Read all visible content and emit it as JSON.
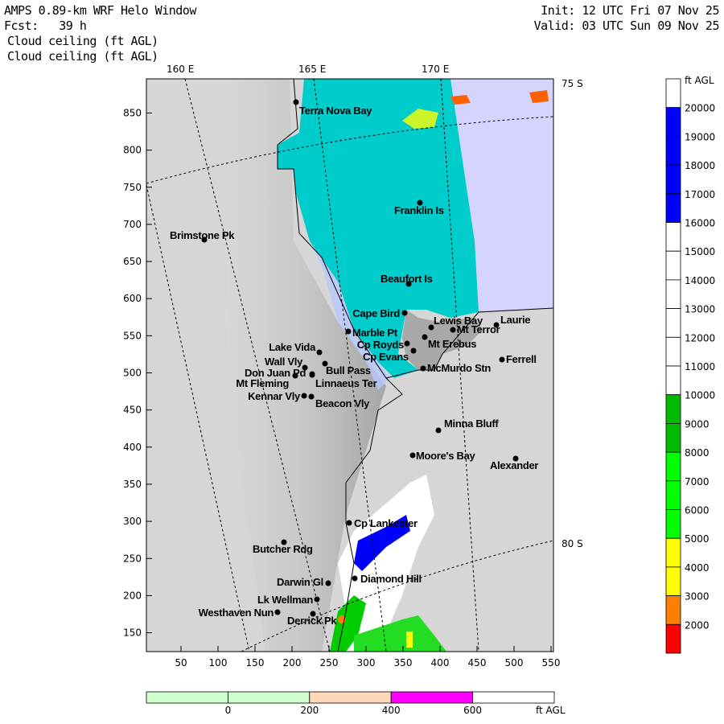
{
  "header": {
    "title": "AMPS 0.89-km WRF Helo Window",
    "forecast": "Fcst:   39 h",
    "field1": "Cloud ceiling (ft AGL)",
    "field2": "Cloud ceiling (ft AGL)",
    "init": "Init: 12 UTC Fri 07 Nov 25",
    "valid": "Valid: 03 UTC Sun 09 Nov 25"
  },
  "map": {
    "lon_labels": [
      "160 E",
      "165 E",
      "170 E"
    ],
    "lat_labels": [
      "75 S",
      "80 S"
    ],
    "x_ticks": [
      "50",
      "100",
      "150",
      "200",
      "250",
      "300",
      "350",
      "400",
      "450",
      "500",
      "550"
    ],
    "y_ticks": [
      "850",
      "800",
      "750",
      "700",
      "650",
      "600",
      "550",
      "500",
      "450",
      "400",
      "350",
      "300",
      "250",
      "200",
      "150"
    ],
    "stations": [
      "Terra Nova Bay",
      "Franklin Is",
      "Brimstone Pk",
      "Beaufort Is",
      "Cape Bird",
      "Lewis Bay",
      "Mt Terror",
      "Laurie",
      "Marble Pt",
      "Mt Erebus",
      "Cp Royds",
      "Lake Vida",
      "Cp Evans",
      "Ferrell",
      "Wall Vly",
      "Bull Pass",
      "McMurdo Stn",
      "Don Juan Pd",
      "Mt Fleming",
      "Linnaeus Ter",
      "Kennar Vly",
      "Beacon Vly",
      "Minna Bluff",
      "Moore's Bay",
      "Alexander",
      "Cp Lankester",
      "Butcher Rdg",
      "Darwin Gl",
      "Diamond Hill",
      "Lk Wellman",
      "Westhaven Nun",
      "Derrick Pk"
    ]
  },
  "ceiling_colorbar": {
    "unit": "ft AGL",
    "labels": [
      "20000",
      "19000",
      "18000",
      "17000",
      "16000",
      "15000",
      "14000",
      "13000",
      "12000",
      "11000",
      "10000",
      "9000",
      "8000",
      "7000",
      "6000",
      "5000",
      "4000",
      "3000",
      "2000"
    ],
    "colors": [
      "#ffffff",
      "#0000ff",
      "#0000ff",
      "#0000ff",
      "#0000ff",
      "#ffffff",
      "#ffffff",
      "#ffffff",
      "#ffffff",
      "#ffffff",
      "#ffffff",
      "#00bb00",
      "#00bb00",
      "#00ff00",
      "#00ff00",
      "#00ff00",
      "#ffff00",
      "#ffff00",
      "#ff8000",
      "#ff0000"
    ]
  },
  "low_colorbar": {
    "unit": "ft AGL",
    "labels": [
      "0",
      "200",
      "400",
      "600"
    ],
    "colors": [
      "#d0ffd0",
      "#d0ffd0",
      "#ffd8b8",
      "#ff00ff",
      "#ffffff"
    ]
  }
}
